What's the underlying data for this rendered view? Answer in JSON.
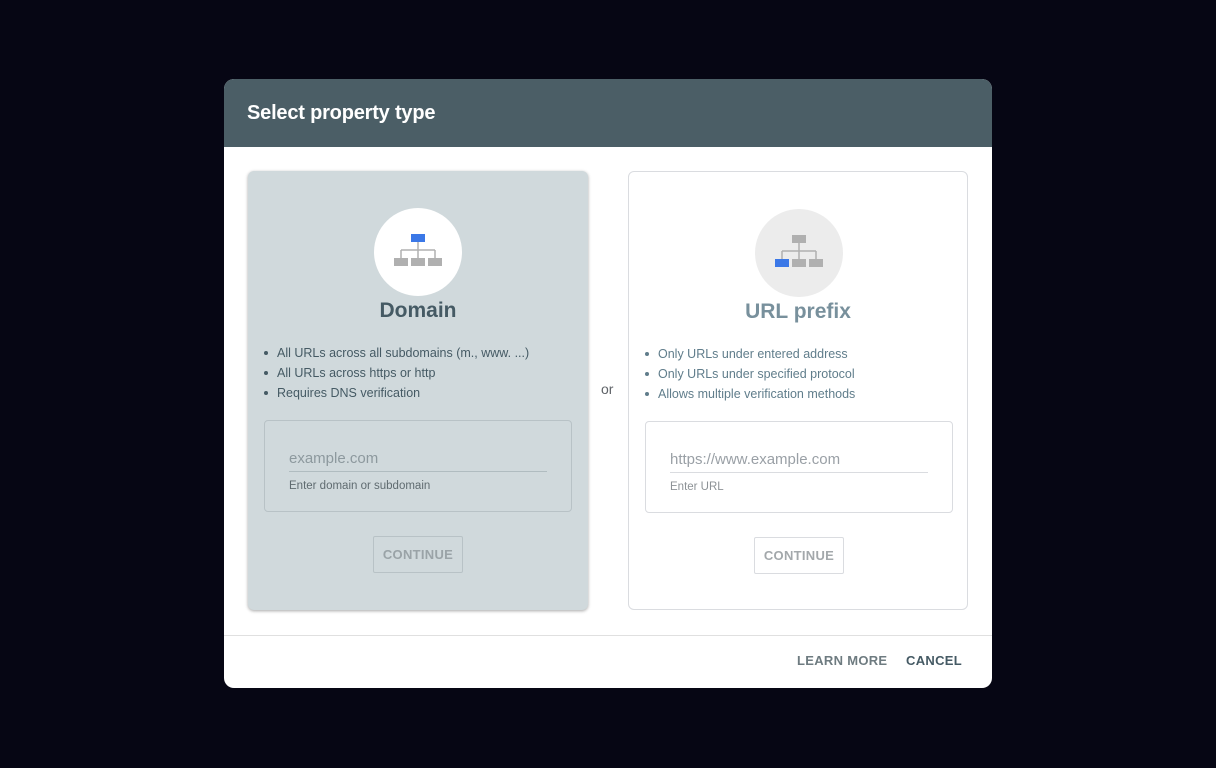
{
  "dialog": {
    "title": "Select property type",
    "separator": "or"
  },
  "cards": {
    "domain": {
      "icon": "domain-hierarchy-icon",
      "title": "Domain",
      "features": [
        "All URLs across all subdomains (m., www. ...)",
        "All URLs across https or http",
        "Requires DNS verification"
      ],
      "input": {
        "placeholder": "example.com",
        "value": "",
        "helper": "Enter domain or subdomain"
      },
      "continue_label": "CONTINUE"
    },
    "prefix": {
      "icon": "url-prefix-hierarchy-icon",
      "title": "URL prefix",
      "features": [
        "Only URLs under entered address",
        "Only URLs under specified protocol",
        "Allows multiple verification methods"
      ],
      "input": {
        "placeholder": "https://www.example.com",
        "value": "",
        "helper": "Enter URL"
      },
      "continue_label": "CONTINUE"
    }
  },
  "footer": {
    "learn_more": "LEARN MORE",
    "cancel": "CANCEL"
  },
  "colors": {
    "header_bg": "#4b5e66",
    "selected_card_bg": "#d0d9dc",
    "icon_accent": "#3b78e7",
    "icon_gray": "#b0b0b0"
  }
}
